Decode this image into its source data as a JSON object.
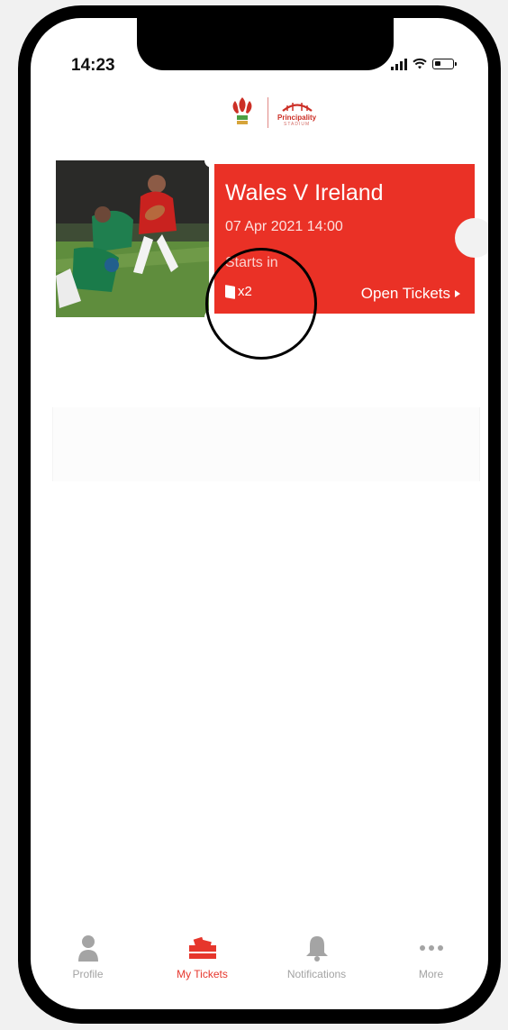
{
  "status_bar": {
    "time": "14:23"
  },
  "ticket": {
    "title": "Wales V Ireland",
    "date": "07 Apr 2021 14:00",
    "starts_in": "Starts in",
    "count": "x2",
    "open_label": "Open Tickets"
  },
  "tabbar": {
    "items": [
      {
        "label": "Profile",
        "icon": "person-icon",
        "active": false
      },
      {
        "label": "My Tickets",
        "icon": "tickets-icon",
        "active": true
      },
      {
        "label": "Notifications",
        "icon": "bell-icon",
        "active": false
      },
      {
        "label": "More",
        "icon": "more-dots-icon",
        "active": false
      }
    ]
  },
  "colors": {
    "accent": "#ea3126",
    "inactive_tab": "#a3a3a3"
  }
}
